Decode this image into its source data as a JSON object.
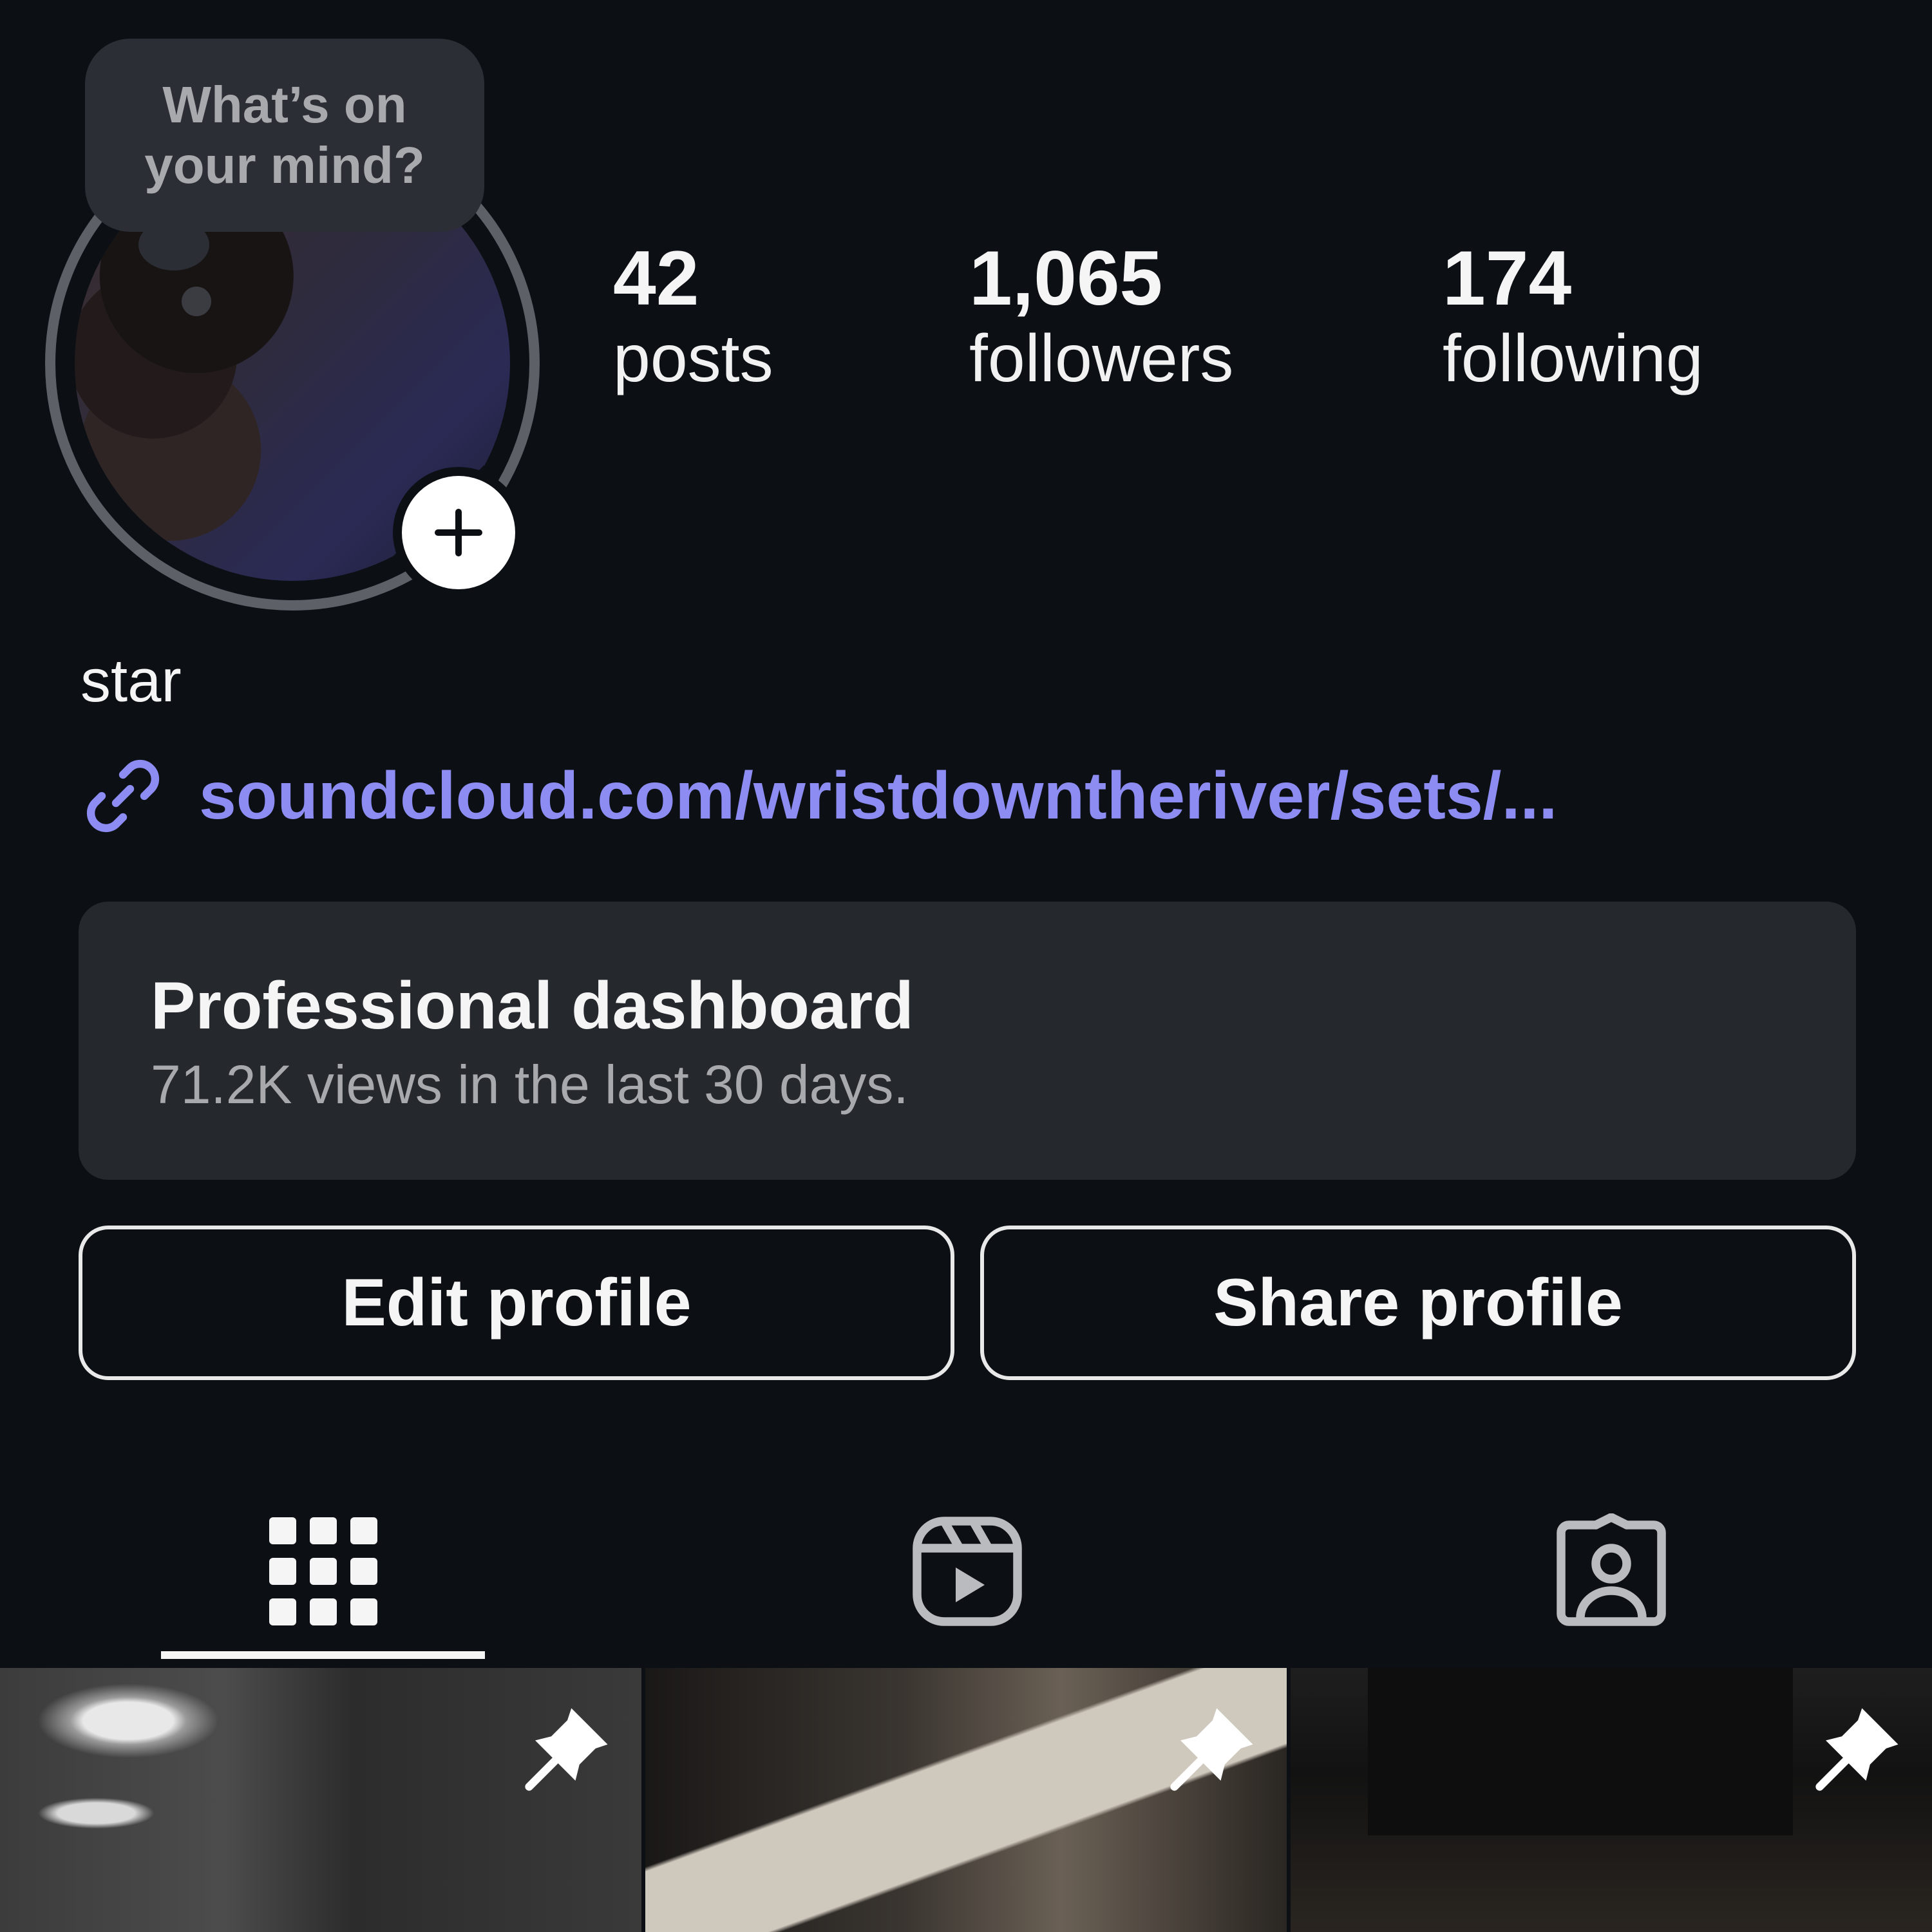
{
  "note": {
    "line1": "What’s on",
    "line2": "your mind?"
  },
  "stats": {
    "posts": {
      "value": "42",
      "label": "posts"
    },
    "followers": {
      "value": "1,065",
      "label": "followers"
    },
    "following": {
      "value": "174",
      "label": "following"
    }
  },
  "profile": {
    "name": "star",
    "link": "soundcloud.com/wristdowntheriver/sets/..."
  },
  "dashboard": {
    "title": "Professional dashboard",
    "subtitle": "71.2K views in the last 30 days."
  },
  "actions": {
    "edit_label": "Edit profile",
    "share_label": "Share profile"
  },
  "tabs": [
    {
      "icon": "grid-icon",
      "selected": true
    },
    {
      "icon": "reels-icon",
      "selected": false
    },
    {
      "icon": "tagged-icon",
      "selected": false
    }
  ],
  "posts": [
    {
      "pinned": true
    },
    {
      "pinned": true
    },
    {
      "pinned": true
    }
  ],
  "colors": {
    "background": "#0c1015",
    "card": "#25282d",
    "link": "#8c8cf2",
    "muted_text": "#a7a9ad"
  }
}
